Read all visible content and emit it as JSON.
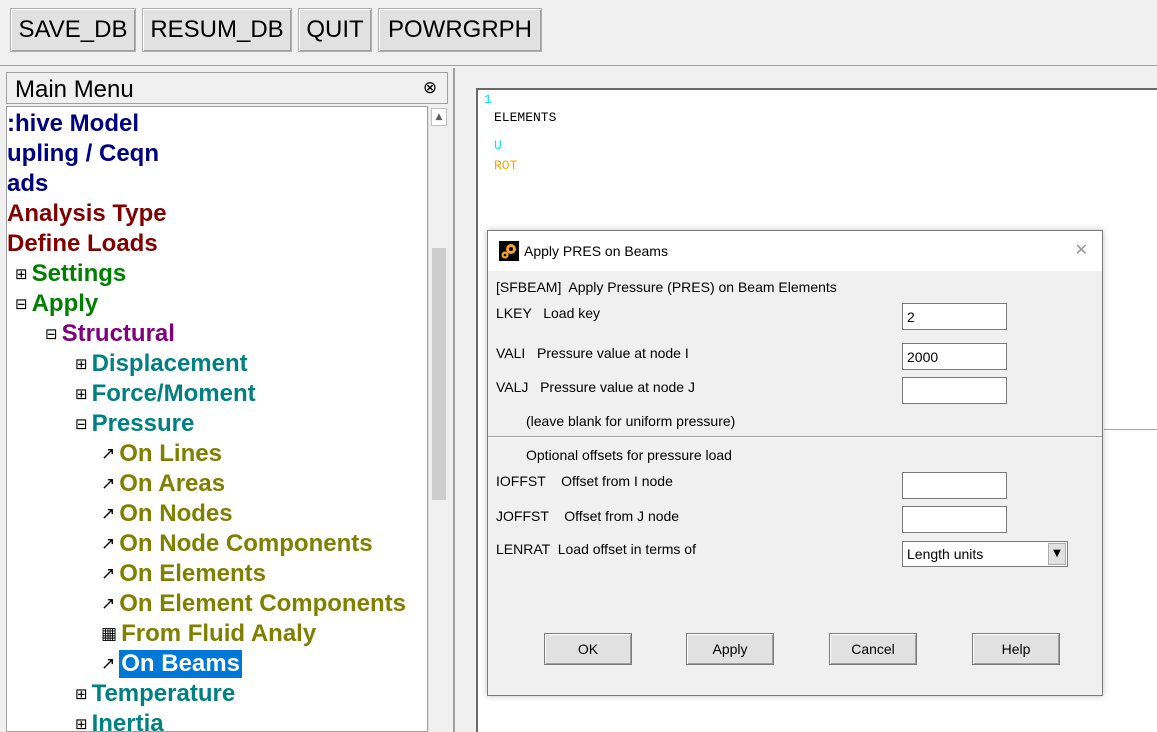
{
  "toolbar": {
    "buttons": [
      "SAVE_DB",
      "RESUM_DB",
      "QUIT",
      "POWRGRPH"
    ]
  },
  "main_menu": {
    "title": "Main Menu",
    "collapse_icon": "double-chevron-up-icon",
    "tree": [
      {
        "label": ":hive Model",
        "color": "#000080"
      },
      {
        "label": "upling / Ceqn",
        "color": "#000080"
      },
      {
        "label": "ads",
        "color": "#000080"
      },
      {
        "label": "Analysis Type",
        "color": "#800000"
      },
      {
        "label": "Define Loads",
        "color": "#800000"
      },
      {
        "prefix": "⊞",
        "label": "Settings",
        "color": "#008000"
      },
      {
        "prefix": "⊟",
        "label": "Apply",
        "color": "#008000"
      },
      {
        "prefix": "⊟",
        "label": "Structural",
        "color": "#800080"
      },
      {
        "prefix": "⊞",
        "label": "Displacement",
        "color": "#008080"
      },
      {
        "prefix": "⊞",
        "label": "Force/Moment",
        "color": "#008080"
      },
      {
        "prefix": "⊟",
        "label": "Pressure",
        "color": "#008080"
      },
      {
        "prefix": "↗",
        "label": "On Lines",
        "color": "#808000"
      },
      {
        "prefix": "↗",
        "label": "On Areas",
        "color": "#808000"
      },
      {
        "prefix": "↗",
        "label": "On Nodes",
        "color": "#808000"
      },
      {
        "prefix": "↗",
        "label": "On Node Components",
        "color": "#808000"
      },
      {
        "prefix": "↗",
        "label": "On Elements",
        "color": "#808000"
      },
      {
        "prefix": "↗",
        "label": "On Element Components",
        "color": "#808000"
      },
      {
        "prefix": "▦",
        "label": "From Fluid Analy",
        "color": "#808000"
      },
      {
        "prefix": "↗",
        "label": "On Beams",
        "color": "#808000",
        "selected": true
      },
      {
        "prefix": "⊞",
        "label": "Temperature",
        "color": "#008080"
      },
      {
        "prefix": "⊞",
        "label": "Inertia",
        "color": "#008080"
      }
    ]
  },
  "graphics": {
    "window_number": "1",
    "title": "ELEMENTS",
    "legend_u": "U",
    "legend_rot": "ROT"
  },
  "dialog": {
    "title": "Apply PRES on Beams",
    "close_icon": "close-icon",
    "heading": "[SFBEAM]  Apply Pressure (PRES) on Beam Elements",
    "lkey_label": "LKEY   Load key",
    "lkey_value": "2",
    "vali_label": "VALI   Pressure value at node I",
    "vali_value": "2000",
    "valj_label": "VALJ   Pressure value at node J",
    "valj_value": "",
    "valj_note": "(leave blank for uniform pressure)",
    "offsets_heading": "Optional offsets for pressure load",
    "ioffst_label": "IOFFST    Offset from I node",
    "ioffst_value": "",
    "joffst_label": "JOFFST    Offset from J node",
    "joffst_value": "",
    "lenrat_label": "LENRAT  Load offset in terms of",
    "lenrat_value": "Length units",
    "buttons": {
      "ok": "OK",
      "apply": "Apply",
      "cancel": "Cancel",
      "help": "Help"
    }
  }
}
